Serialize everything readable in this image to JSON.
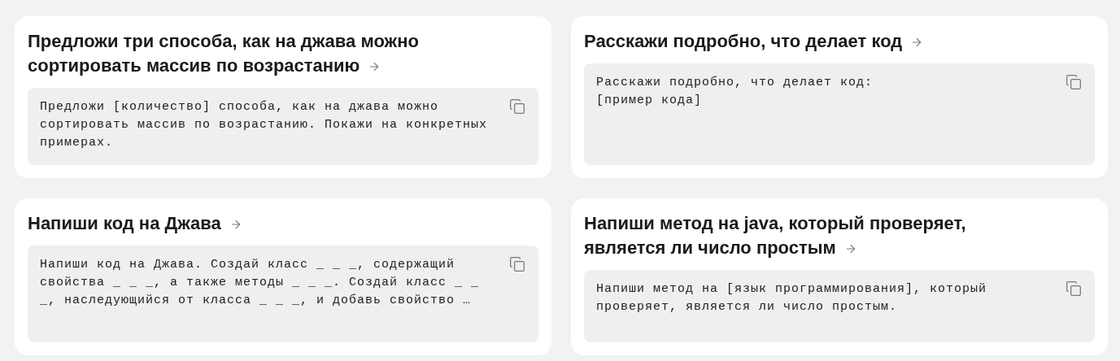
{
  "cards": [
    {
      "title": "Предложи три способа, как на джава можно сортировать массив по возрастанию",
      "prompt": "Предложи [количество] способа, как на джава можно сортировать массив по возрастанию. Покажи на конкретных примерах."
    },
    {
      "title": "Расскажи подробно, что делает код",
      "prompt": "Расскажи подробно, что делает код:\n[пример кода]"
    },
    {
      "title": "Напиши код на Джава",
      "prompt": "Напиши код на Джава. Создай класс _ _ _, содержащий свойства _ _ _, а также методы _ _ _. Создай класс _ _ _, наследующийся от класса _ _ _, и добавь свойство …"
    },
    {
      "title": "Напиши метод на java, который проверяет, является ли число простым",
      "prompt": "Напиши метод на [язык программирования], который проверяет, является ли число простым."
    }
  ]
}
